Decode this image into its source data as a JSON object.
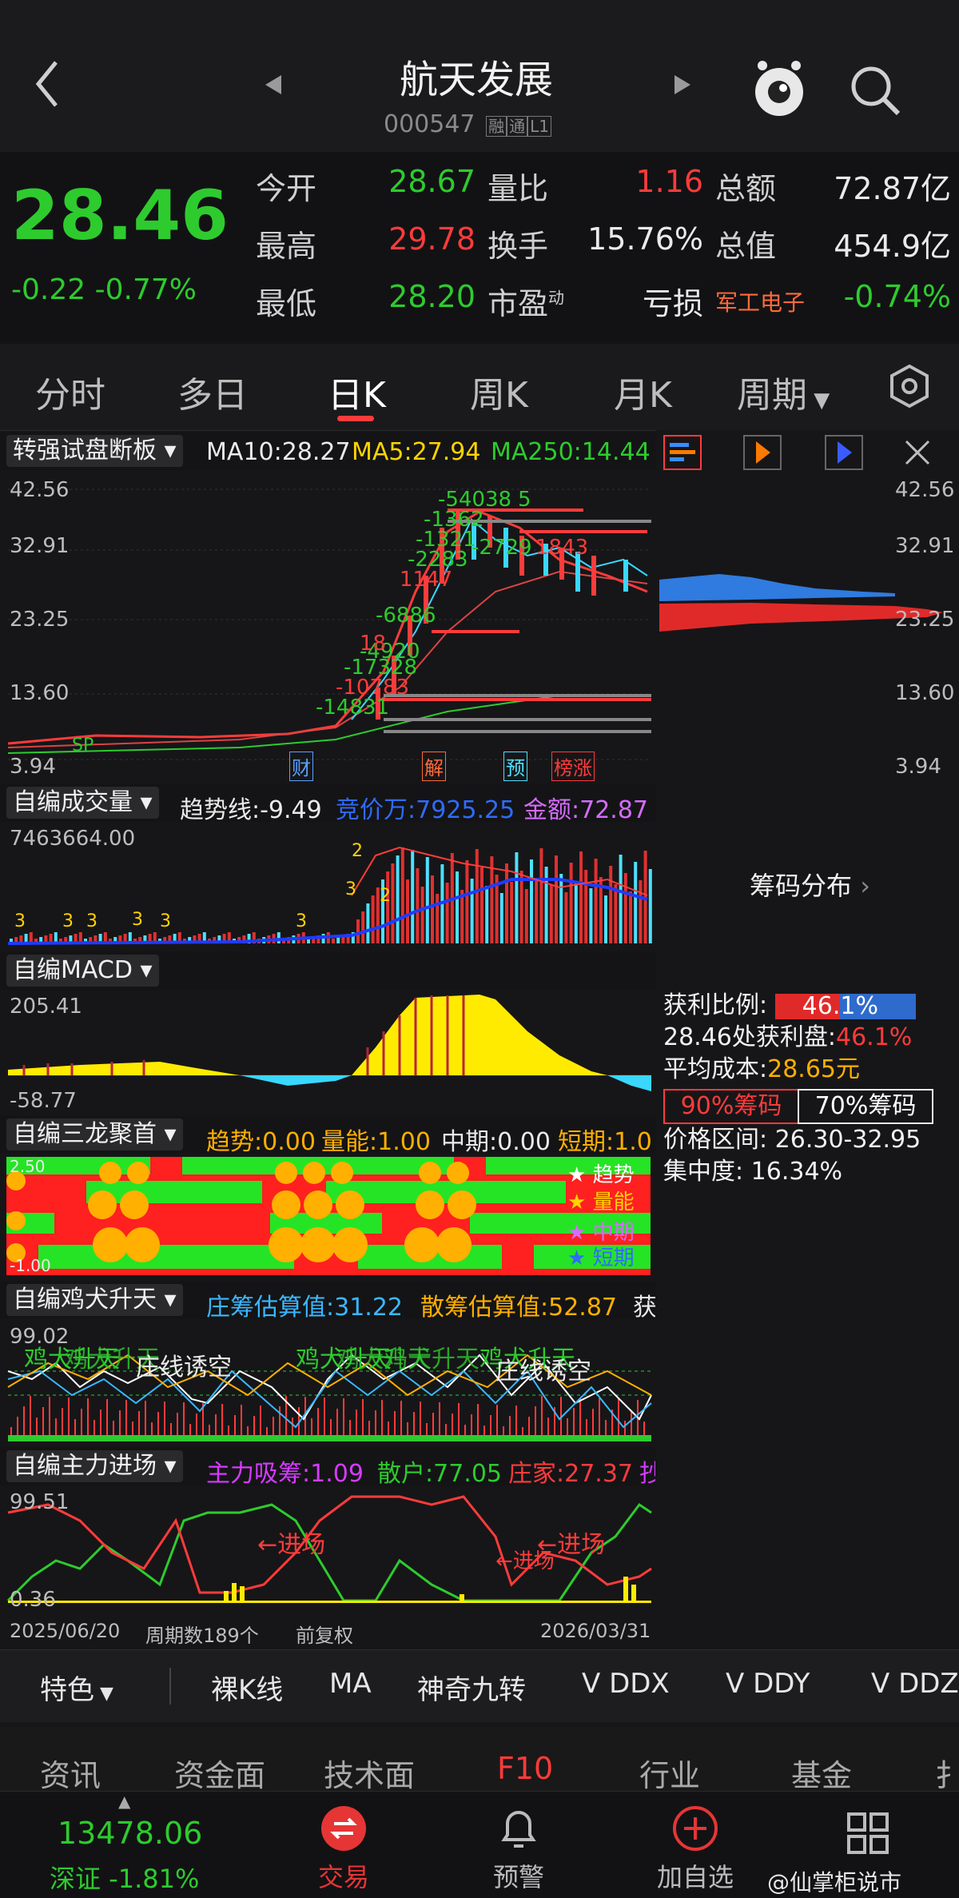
{
  "header": {
    "title": "航天发展",
    "code": "000547",
    "badges": [
      "融",
      "通",
      "L1"
    ]
  },
  "quote": {
    "price": "28.46",
    "change": "-0.22",
    "change_pct": "-0.77%",
    "rows": [
      [
        {
          "k": "今开",
          "v": "28.67",
          "c": "#2ecb2e"
        },
        {
          "k": "量比",
          "v": "1.16",
          "c": "#ff3b3b"
        },
        {
          "k": "总额",
          "v": "72.87亿",
          "c": "#eaeaea"
        }
      ],
      [
        {
          "k": "最高",
          "v": "29.78",
          "c": "#ff3b3b"
        },
        {
          "k": "换手",
          "v": "15.76%",
          "c": "#eaeaea"
        },
        {
          "k": "总值",
          "v": "454.9亿",
          "c": "#eaeaea"
        }
      ],
      [
        {
          "k": "最低",
          "v": "28.20",
          "c": "#2ecb2e"
        },
        {
          "k": "市盈",
          "v": "亏损",
          "c": "#eaeaea"
        },
        {
          "k": "军工电子",
          "v": "-0.74%",
          "c": "#2ecb2e"
        }
      ]
    ],
    "pe_sup": "动"
  },
  "tabs": [
    "分时",
    "多日",
    "日K",
    "周K",
    "月K",
    "周期"
  ],
  "kline": {
    "selector": "转强试盘断板",
    "ma10": "MA10:28.27",
    "ma5": "MA5:27.94",
    "ma250": "MA250:14.44",
    "yticks": [
      "42.56",
      "32.91",
      "23.25",
      "13.60",
      "3.94"
    ],
    "annotations": [
      "-54038",
      "5",
      "-1321",
      "-2283",
      "1147",
      "-6886",
      "-4920",
      "-17328",
      "-10783",
      "-14831",
      "-2729",
      "1843",
      "18",
      "-1362",
      "SP"
    ],
    "event_tags": [
      "财",
      "解",
      "预",
      "榜涨"
    ]
  },
  "volume": {
    "selector": "自编成交量",
    "trend": "趋势线:-9.49",
    "auction": "竞价万:7925.25",
    "amount": "金额:72.87",
    "ymax": "7463664.00",
    "marks": [
      "3",
      "3",
      "3",
      "3",
      "3",
      "3",
      "2",
      "3",
      "2"
    ]
  },
  "macd": {
    "selector": "自编MACD",
    "ymax": "205.41",
    "ymin": "-58.77"
  },
  "sanlong": {
    "selector": "自编三龙聚首",
    "trend": "趋势:0.00",
    "energy": "量能:1.00",
    "mid": "中期:0.00",
    "short": "短期:1.0",
    "legend": [
      "★ 趋势",
      "★ 量能",
      "★ 中期",
      "★ 短期"
    ],
    "ytop": "2.50",
    "ybot": "-1.00"
  },
  "jiquan": {
    "selector": "自编鸡犬升天",
    "zhuang": "庄筹估算值:31.22",
    "san": "散筹估算值:52.87",
    "more": "获",
    "ytop": "99.02",
    "texts": [
      "鸡犬升天",
      "鸡犬升天",
      "鸡犬升天",
      "鸡犬升天",
      "鸡犬升天",
      "鸡犬升天",
      "庄线诱空",
      "庄线诱空"
    ]
  },
  "zhuli": {
    "selector": "自编主力进场",
    "xishou": "主力吸筹:1.09",
    "sanhu": "散户:77.05",
    "zhuangjia": "庄家:27.37",
    "more": "抄",
    "ytop": "99.51",
    "ybot": "0.36",
    "enter1": "←进场",
    "enter2": "←进场",
    "enter3": "←进场"
  },
  "footer": {
    "start": "2025/06/20",
    "count": "周期数189个",
    "adj": "前复权",
    "end": "2026/03/31"
  },
  "chips": {
    "yticks": [
      "42.56",
      "32.91",
      "23.25",
      "13.60",
      "3.94"
    ],
    "title": "筹码分布",
    "profit_ratio_label": "获利比例:",
    "profit_ratio": "46.1%",
    "profit_ratio_value": 0.461,
    "profit_at": "28.46处获利盘:",
    "profit_at_val": "46.1%",
    "avg_cost": "平均成本:",
    "avg_cost_val": "28.65元",
    "btn90": "90%筹码",
    "btn70": "70%筹码",
    "range": "价格区间: 26.30-32.95",
    "concentration": "集中度: 16.34%"
  },
  "toolbar": [
    "特色",
    "裸K线",
    "MA",
    "神奇九转",
    "V DDX",
    "V DDY",
    "V DDZ"
  ],
  "f10": [
    "资讯",
    "资金面",
    "技术面",
    "F10",
    "行业",
    "基金",
    "扌"
  ],
  "nav": {
    "index_val": "13478.06",
    "index_name": "深证 -1.81%",
    "trade": "交易",
    "alert": "预警",
    "add": "加自选",
    "watermark": "@仙掌柜说市"
  }
}
